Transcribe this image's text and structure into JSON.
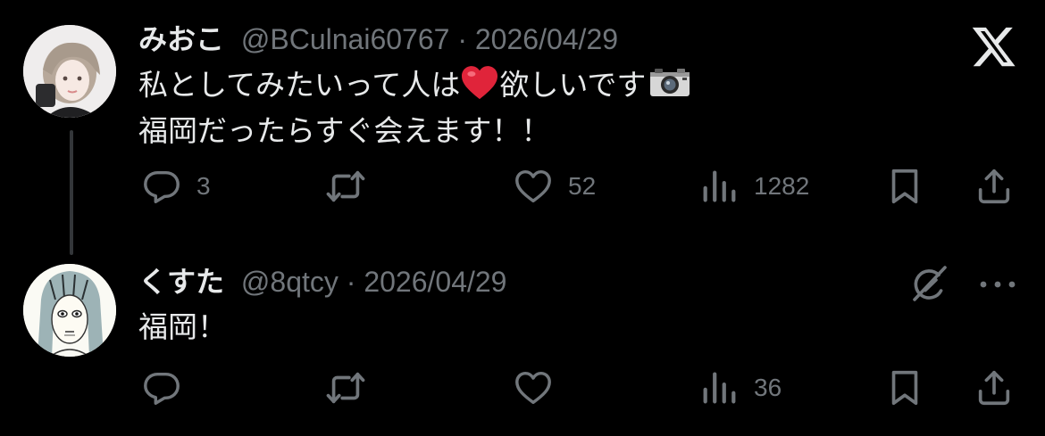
{
  "posts": [
    {
      "display_name": "みおこ",
      "handle": "@BCulnai60767",
      "separator": "·",
      "date": "2026/04/29",
      "line1_before_heart": "私としてみたいって人は",
      "line1_after_heart": "欲しいです",
      "line2": "福岡だったらすぐ会えます！！",
      "replies": "3",
      "reposts": "",
      "likes": "52",
      "views": "1282"
    },
    {
      "display_name": "くすた",
      "handle": "@8qtcy",
      "separator": "·",
      "date": "2026/04/29",
      "text": "福岡！",
      "replies": "",
      "reposts": "",
      "likes": "",
      "views": "36"
    }
  ],
  "colors": {
    "background": "#000000",
    "primary_text": "#e7e9ea",
    "secondary_text": "#71767b",
    "heart_emoji": "#e0243a"
  },
  "icons": [
    "x-logo-icon",
    "reply-icon",
    "repost-icon",
    "like-icon",
    "views-icon",
    "bookmark-icon",
    "share-icon",
    "grok-icon",
    "more-icon",
    "camera-icon",
    "heart-emoji-icon"
  ]
}
